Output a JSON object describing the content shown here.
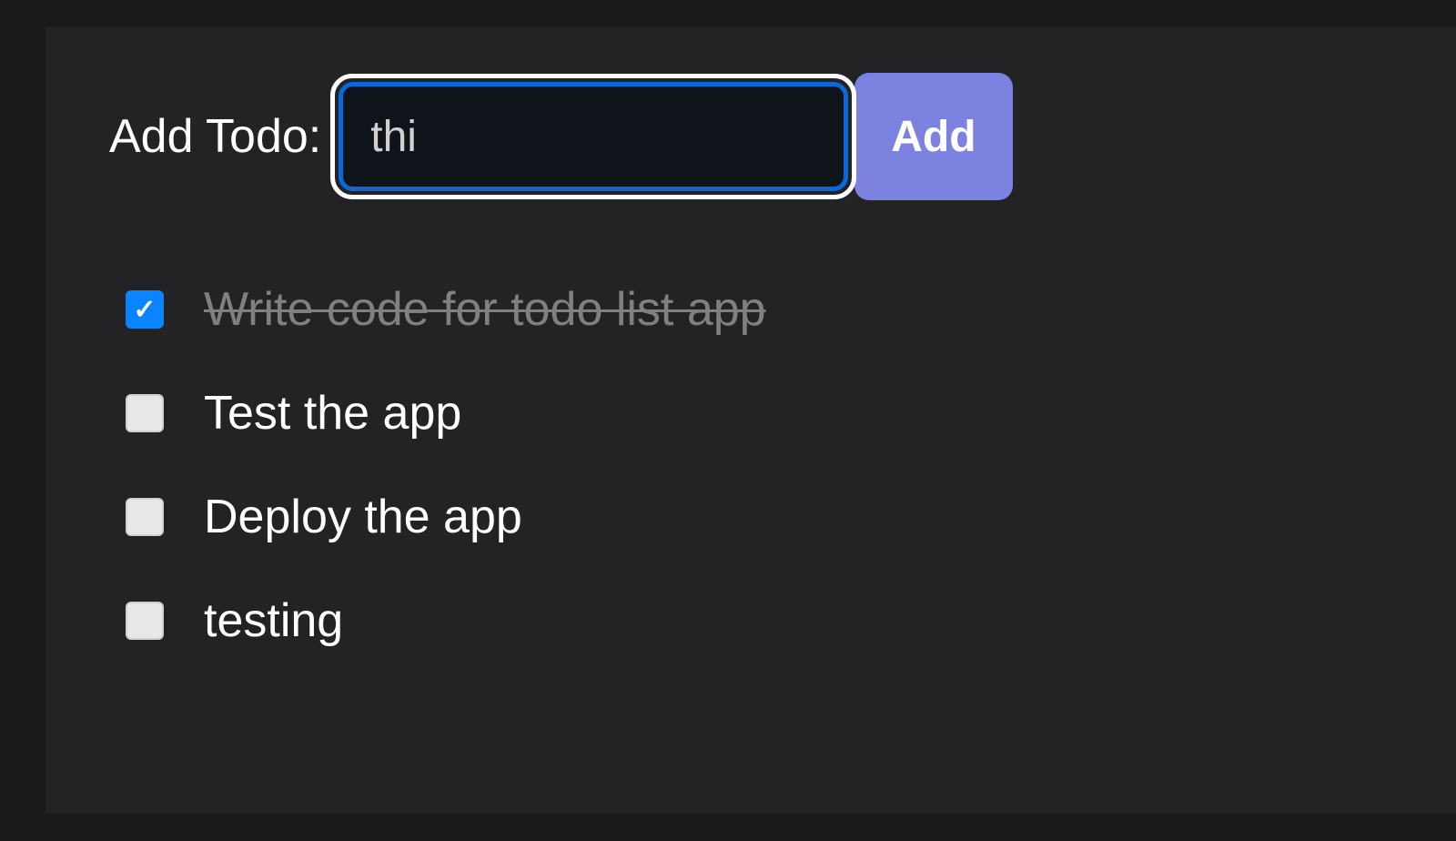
{
  "form": {
    "label": "Add Todo:",
    "input_value": "thi",
    "button_label": "Add"
  },
  "todos": [
    {
      "text": "Write code for todo list app",
      "completed": true
    },
    {
      "text": "Test the app",
      "completed": false
    },
    {
      "text": "Deploy the app",
      "completed": false
    },
    {
      "text": "testing",
      "completed": false
    }
  ]
}
